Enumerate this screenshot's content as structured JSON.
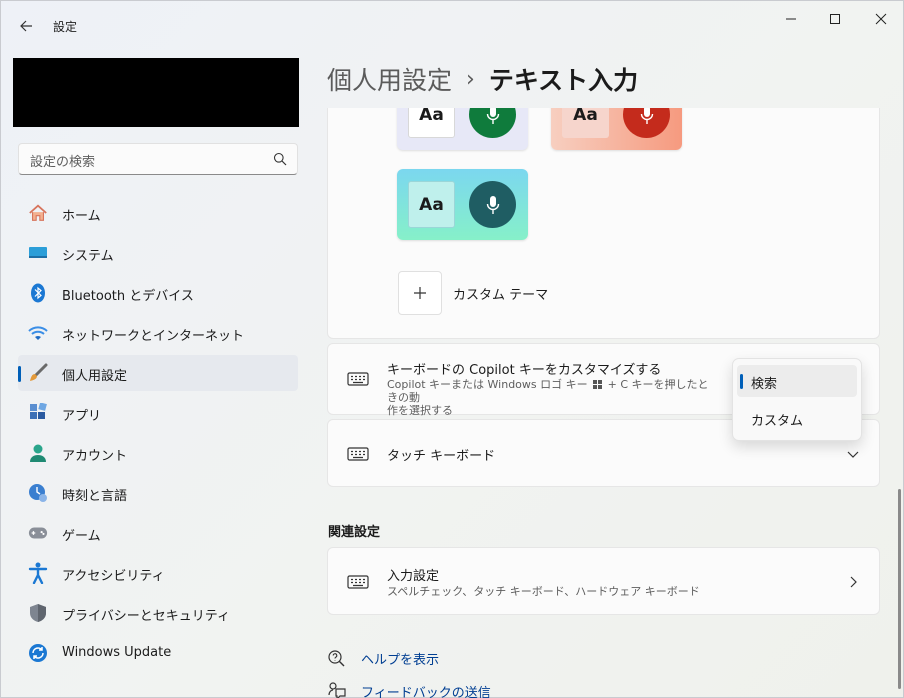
{
  "window": {
    "title": "設定",
    "controls": [
      "minimize-icon",
      "maximize-icon",
      "close-icon"
    ]
  },
  "sidebar": {
    "search_placeholder": "設定の検索",
    "items": [
      {
        "label": "ホーム",
        "icon": "home-icon"
      },
      {
        "label": "システム",
        "icon": "system-icon"
      },
      {
        "label": "Bluetooth とデバイス",
        "icon": "bluetooth-icon"
      },
      {
        "label": "ネットワークとインターネット",
        "icon": "wifi-icon"
      },
      {
        "label": "個人用設定",
        "icon": "brush-icon",
        "active": true
      },
      {
        "label": "アプリ",
        "icon": "apps-icon"
      },
      {
        "label": "アカウント",
        "icon": "account-icon"
      },
      {
        "label": "時刻と言語",
        "icon": "time-language-icon"
      },
      {
        "label": "ゲーム",
        "icon": "gamepad-icon"
      },
      {
        "label": "アクセシビリティ",
        "icon": "accessibility-icon"
      },
      {
        "label": "プライバシーとセキュリティ",
        "icon": "shield-icon"
      },
      {
        "label": "Windows Update",
        "icon": "update-icon"
      }
    ]
  },
  "header": {
    "parent": "個人用設定",
    "separator": "›",
    "current": "テキスト入力"
  },
  "themes": {
    "cards": [
      {
        "aa": "Aa",
        "colors": {
          "bg": "#e7e8f7",
          "mic": "#0f7b3c"
        }
      },
      {
        "aa": "Aa",
        "colors": {
          "bg": "#f7b2a0",
          "mic": "#c42b1c"
        }
      },
      {
        "aa": "Aa",
        "colors": {
          "bg": "#7ad8e8",
          "mic": "#1f5d63"
        }
      }
    ],
    "custom_label": "カスタム テーマ"
  },
  "copilot_key": {
    "title": "キーボードの Copilot キーをカスタマイズする",
    "desc_line1": "Copilot キーまたは Windows ロゴ キー",
    "desc_plus": "+ C キーを押したときの動",
    "desc_line2": "作を選択する",
    "dropdown": {
      "options": [
        "検索",
        "カスタム"
      ],
      "selected": "検索"
    }
  },
  "touch_keyboard": {
    "title": "タッチ キーボード"
  },
  "related": {
    "section_title": "関連設定",
    "input_settings": {
      "title": "入力設定",
      "desc": "スペルチェック、タッチ キーボード、ハードウェア キーボード"
    }
  },
  "links": {
    "help": "ヘルプを表示",
    "feedback": "フィードバックの送信"
  },
  "colors": {
    "accent": "#005fb8",
    "link": "#003e92"
  }
}
